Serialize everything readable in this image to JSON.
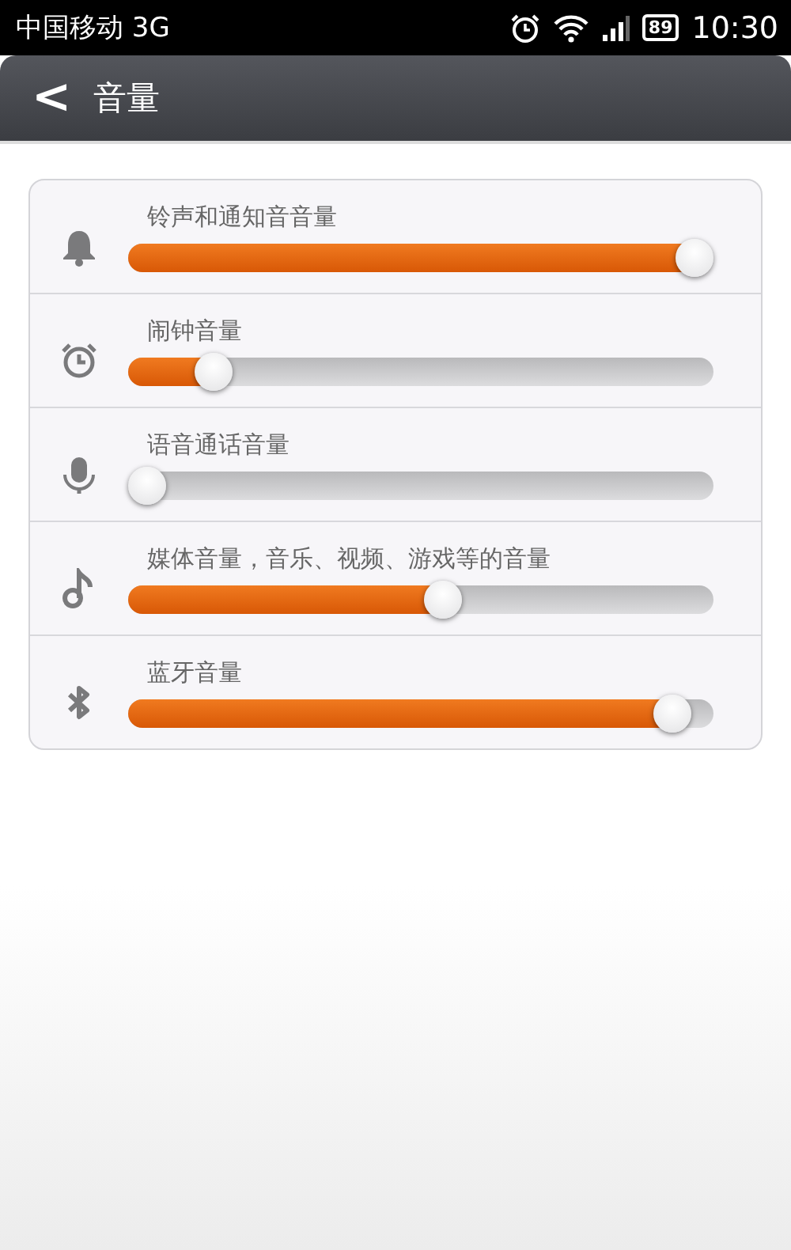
{
  "status_bar": {
    "carrier": "中国移动 3G",
    "battery": "89",
    "time": "10:30"
  },
  "header": {
    "back": "<",
    "title": "音量"
  },
  "volumes": [
    {
      "kind": "ringtone",
      "label": "铃声和通知音音量",
      "level": 1.0
    },
    {
      "kind": "alarm",
      "label": "闹钟音量",
      "level": 0.12
    },
    {
      "kind": "voice_call",
      "label": "语音通话音量",
      "level": 0.0
    },
    {
      "kind": "media",
      "label": "媒体音量，音乐、视频、游戏等的音量",
      "level": 0.54
    },
    {
      "kind": "bluetooth",
      "label": "蓝牙音量",
      "level": 0.96
    }
  ]
}
